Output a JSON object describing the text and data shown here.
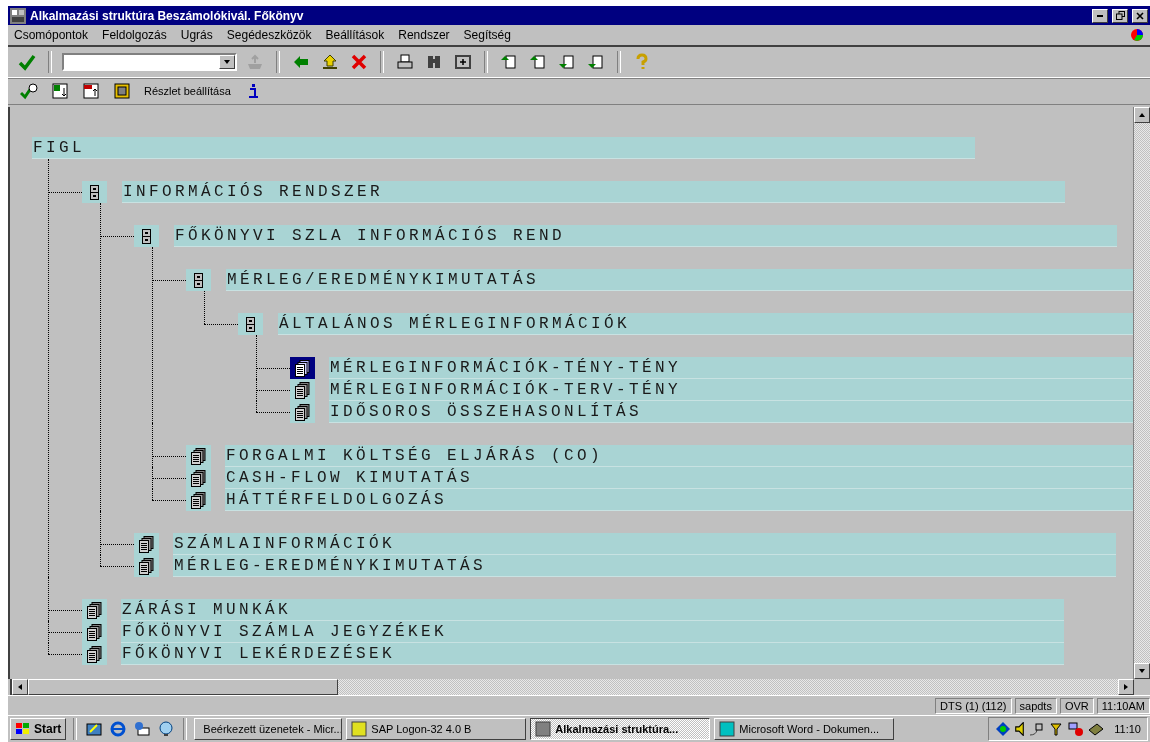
{
  "window": {
    "title": "Alkalmazási struktúra Beszámolókivál. Főkönyv"
  },
  "menu": [
    "Csomópontok",
    "Feldolgozás",
    "Ugrás",
    "Segédeszközök",
    "Beállítások",
    "Rendszer",
    "Segítség"
  ],
  "app_toolbar": {
    "detail_button": "Részlet beállítása"
  },
  "tree": {
    "label": "FIGL",
    "children": [
      {
        "label": "INFORMÁCIÓS RENDSZER",
        "kind": "folder",
        "selected": false,
        "children": [
          {
            "label": "FŐKÖNYVI SZLA INFORMÁCIÓS REND",
            "kind": "folder",
            "selected": false,
            "children": [
              {
                "label": "MÉRLEG/EREDMÉNYKIMUTATÁS",
                "kind": "folder",
                "selected": false,
                "children": [
                  {
                    "label": "ÁLTALÁNOS MÉRLEGINFORMÁCIÓK",
                    "kind": "folder",
                    "selected": false,
                    "children": [
                      {
                        "label": "MÉRLEGINFORMÁCIÓK-TÉNY-TÉNY",
                        "kind": "report",
                        "selected": true
                      },
                      {
                        "label": "MÉRLEGINFORMÁCIÓK-TERV-TÉNY",
                        "kind": "report",
                        "selected": false
                      },
                      {
                        "label": "IDŐSOROS ÖSSZEHASONLÍTÁS",
                        "kind": "report",
                        "selected": false
                      }
                    ]
                  }
                ]
              },
              {
                "label": "FORGALMI KÖLTSÉG ELJÁRÁS (CO)",
                "kind": "report",
                "selected": false
              },
              {
                "label": "CASH-FLOW KIMUTATÁS",
                "kind": "report",
                "selected": false
              },
              {
                "label": "HÁTTÉRFELDOLGOZÁS",
                "kind": "report",
                "selected": false
              }
            ]
          },
          {
            "label": "SZÁMLAINFORMÁCIÓK",
            "kind": "report",
            "selected": false
          },
          {
            "label": "MÉRLEG-EREDMÉNYKIMUTATÁS",
            "kind": "report",
            "selected": false
          }
        ]
      },
      {
        "label": "ZÁRÁSI MUNKÁK",
        "kind": "report",
        "selected": false
      },
      {
        "label": "FŐKÖNYVI SZÁMLA JEGYZÉKEK",
        "kind": "report",
        "selected": false
      },
      {
        "label": "FŐKÖNYVI LEKÉRDEZÉSEK",
        "kind": "report",
        "selected": false
      }
    ]
  },
  "status_bar": [
    "DTS (1) (112)",
    "sapdts",
    "OVR",
    "11:10AM"
  ],
  "taskbar": {
    "start": "Start",
    "tasks": [
      {
        "label": "Beérkezett üzenetek - Micr...",
        "selected": false
      },
      {
        "label": "SAP Logon-32 4.0 B",
        "selected": false
      },
      {
        "label": "Alkalmazási struktúra...",
        "selected": true
      },
      {
        "label": "Microsoft Word - Dokumen...",
        "selected": false
      }
    ],
    "clock": "11:10"
  }
}
